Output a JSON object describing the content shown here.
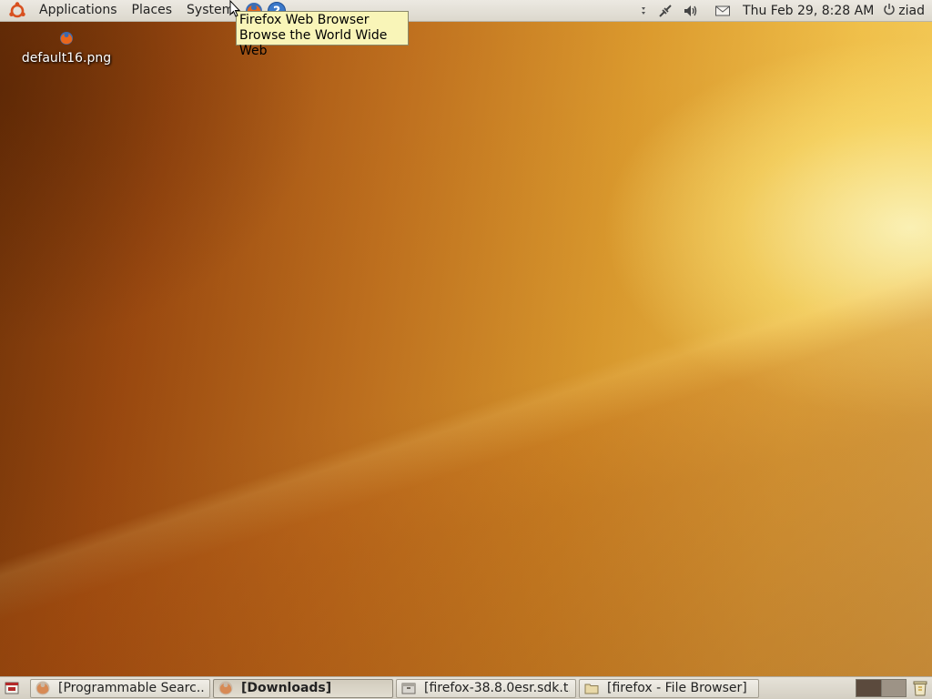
{
  "top_panel": {
    "menus": [
      "Applications",
      "Places",
      "System"
    ],
    "launchers": [
      {
        "icon": "firefox-icon",
        "name": "Firefox Web Browser"
      },
      {
        "icon": "help-icon",
        "name": "Help"
      }
    ],
    "tray_icons": [
      "notification-arrow-icon",
      "network-disconnected-icon",
      "volume-icon",
      "mail-icon"
    ],
    "clock": "Thu Feb 29,  8:28 AM",
    "user": {
      "icon": "power-icon",
      "name": "ziad"
    }
  },
  "tooltip": {
    "line1": "Firefox Web Browser",
    "line2": "Browse the World Wide Web"
  },
  "desktop": {
    "icons": [
      {
        "label": "default16.png",
        "icon": "firefox-image-icon"
      }
    ]
  },
  "bottom_panel": {
    "show_desktop_icon": "show-desktop-icon",
    "tasks": [
      {
        "label": "[Programmable Searc...",
        "icon": "firefox-icon",
        "active": false
      },
      {
        "label": "[Downloads]",
        "icon": "firefox-icon",
        "active": true
      },
      {
        "label": "[firefox-38.8.0esr.sdk.t...",
        "icon": "archive-icon",
        "active": false
      },
      {
        "label": "[firefox - File Browser]",
        "icon": "folder-icon",
        "active": false
      }
    ],
    "workspaces": 2,
    "trash_icon": "trash-icon"
  },
  "colors": {
    "panel": "#dcd8cd",
    "tooltip_bg": "#f9f5b8",
    "wallpaper_dark": "#6e3208",
    "wallpaper_light": "#f6d262"
  }
}
